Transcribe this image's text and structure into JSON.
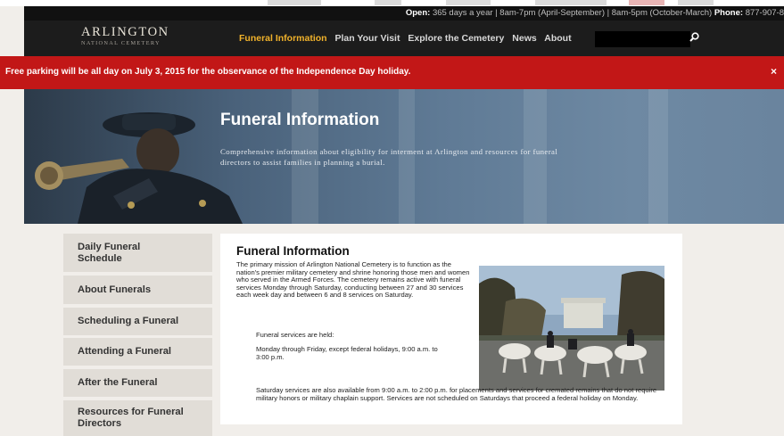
{
  "info_bar": {
    "open_label": "Open:",
    "open_text": "365 days a year  |  8am-7pm (April-September)  |  8am-5pm (October-March)",
    "phone_label": "Phone:",
    "phone_text": "877-907-8"
  },
  "header": {
    "logo_title": "ARLINGTON",
    "logo_subtitle": "NATIONAL CEMETERY",
    "nav": [
      {
        "label": "Funeral Information",
        "active": true
      },
      {
        "label": "Plan Your Visit",
        "active": false
      },
      {
        "label": "Explore the Cemetery",
        "active": false
      },
      {
        "label": "News",
        "active": false
      },
      {
        "label": "About",
        "active": false
      }
    ],
    "search_value": "",
    "search_icon": "search-icon"
  },
  "alert": {
    "text": "Free parking will be all day on July 3, 2015 for the observance of the Independence Day holiday.",
    "close": "×"
  },
  "hero": {
    "title": "Funeral Information",
    "description": "Comprehensive information about eligibility for interment at Arlington and resources for funeral directors to assist families in planning a burial."
  },
  "sidebar": {
    "items": [
      {
        "label": "Daily Funeral Schedule"
      },
      {
        "label": "About Funerals"
      },
      {
        "label": "Scheduling a Funeral"
      },
      {
        "label": "Attending a Funeral"
      },
      {
        "label": "After the Funeral"
      },
      {
        "label": "Resources for Funeral Directors"
      }
    ]
  },
  "main": {
    "title": "Funeral Information",
    "paragraph": "The primary mission of Arlington National Cemetery is to function as the nation's premier military cemetery and shrine honoring those men and women who served in the Armed Forces. The cemetery remains active with funeral services Monday through Saturday, conducting between 27 and 30 services each week day and between 6 and 8 services on Saturday.",
    "hold_label": "Funeral services are held:",
    "weekday": "Monday through Friday, except federal holidays, 9:00 a.m. to 3:00 p.m.",
    "saturday": "Saturday services are also available from 9:00 a.m. to 2:00 p.m. for placements and services for cremated remains that do not require military honors or military chaplain support. Services are not scheduled on Saturdays that proceed a federal holiday on Monday."
  },
  "colors": {
    "accent": "#f0b22b",
    "alert": "#c21717",
    "header": "#1c1c1c"
  }
}
